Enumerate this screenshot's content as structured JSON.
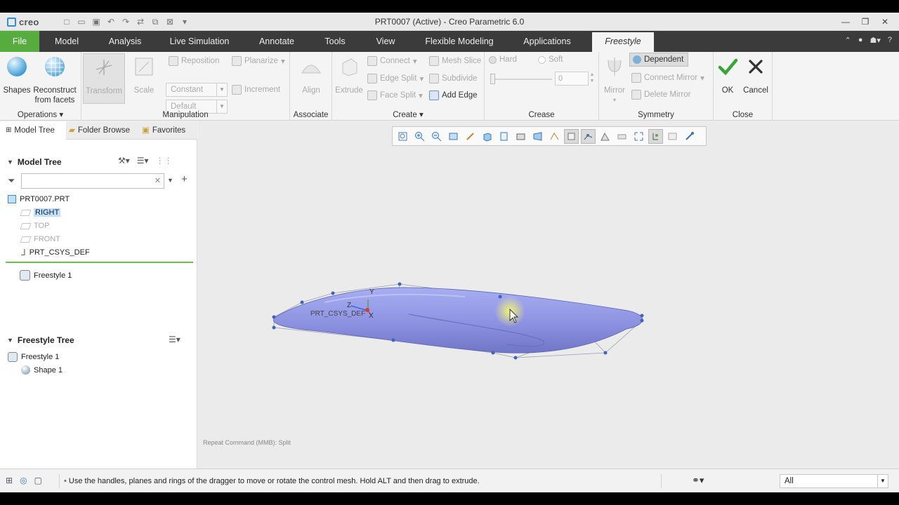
{
  "window": {
    "brand": "creo",
    "title": "PRT0007 (Active) - Creo Parametric 6.0"
  },
  "tabs": [
    "File",
    "Model",
    "Analysis",
    "Live Simulation",
    "Annotate",
    "Tools",
    "View",
    "Flexible Modeling",
    "Applications",
    "Freestyle"
  ],
  "ribbon": {
    "operations": {
      "shapes": "Shapes",
      "reconstruct_line1": "Reconstruct",
      "reconstruct_line2": "from facets",
      "label": "Operations"
    },
    "manipulation": {
      "transform": "Transform",
      "scale": "Scale",
      "reposition": "Reposition",
      "planarize": "Planarize",
      "constant": "Constant",
      "increment": "Increment",
      "default": "Default",
      "label": "Manipulation"
    },
    "associate": {
      "align": "Align",
      "label": "Associate"
    },
    "create": {
      "extrude": "Extrude",
      "connect": "Connect",
      "mesh_slice": "Mesh Slice",
      "edge_split": "Edge Split",
      "subdivide": "Subdivide",
      "face_split": "Face Split",
      "add_edge": "Add Edge",
      "label": "Create"
    },
    "crease": {
      "hard": "Hard",
      "soft": "Soft",
      "value": "0",
      "label": "Crease"
    },
    "symmetry": {
      "mirror": "Mirror",
      "dependent": "Dependent",
      "connect_mirror": "Connect Mirror",
      "delete_mirror": "Delete Mirror",
      "label": "Symmetry"
    },
    "close": {
      "ok": "OK",
      "cancel": "Cancel",
      "label": "Close"
    }
  },
  "left_panel": {
    "tabs": [
      "Model Tree",
      "Folder Browse",
      "Favorites"
    ],
    "model_tree_title": "Model Tree",
    "search_placeholder": "",
    "model_items": [
      "PRT0007.PRT",
      "RIGHT",
      "TOP",
      "FRONT",
      "PRT_CSYS_DEF",
      "Freestyle 1"
    ],
    "freestyle_tree_title": "Freestyle Tree",
    "freestyle_items": [
      "Freestyle 1",
      "Shape 1"
    ]
  },
  "viewport": {
    "csys_label": "PRT_CSYS_DEF",
    "axis_x": "X",
    "axis_y": "Y",
    "axis_z": "Z",
    "repeat_command": "Repeat Command (MMB): Split"
  },
  "status": {
    "message": "Use the handles, planes and rings of the dragger to move or rotate the control mesh. Hold ALT and then drag to extrude.",
    "filter": "All"
  },
  "colors": {
    "file_tab": "#56ac3f",
    "ribbon_dark": "#3b3b3b",
    "shape_fill": "#8d94e2",
    "ok_check": "#3aa33a"
  }
}
